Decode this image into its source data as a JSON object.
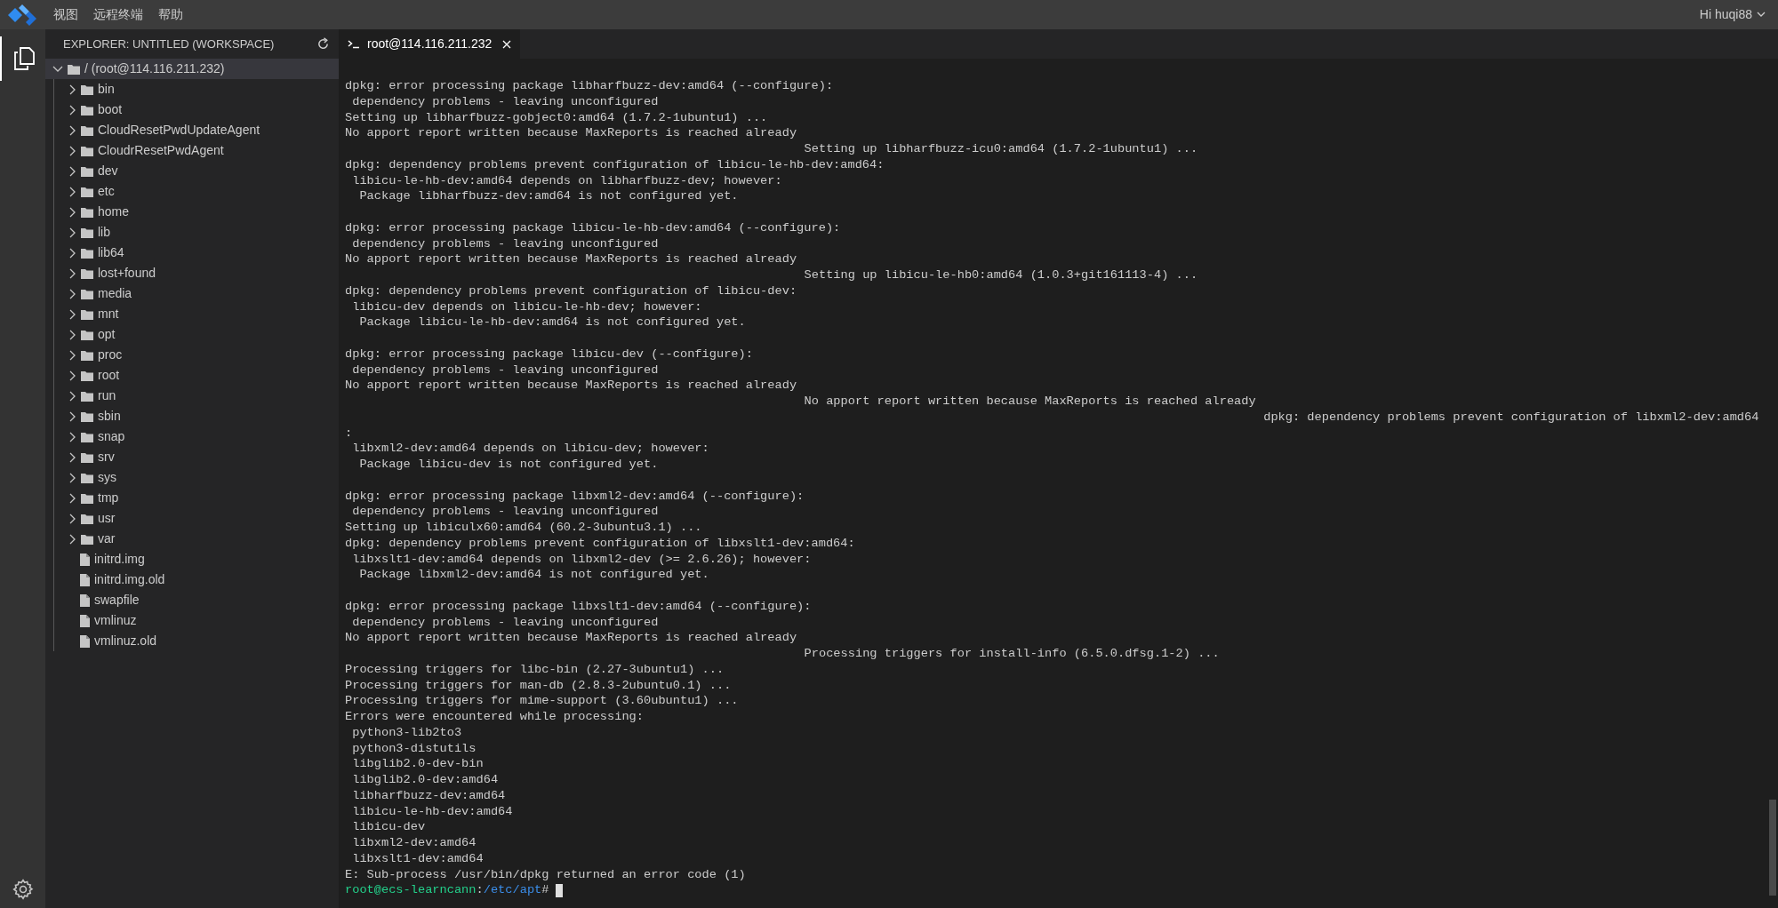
{
  "menu_bar": {
    "items": [
      "视图",
      "远程终端",
      "帮助"
    ],
    "user": "Hi huqi88"
  },
  "explorer": {
    "title": "EXPLORER: UNTITLED (WORKSPACE)",
    "tree": [
      {
        "label": "/ (root@114.116.211.232)",
        "kind": "folder",
        "expanded": true,
        "selected": true,
        "children": [
          {
            "label": "bin",
            "kind": "folder",
            "expanded": false
          },
          {
            "label": "boot",
            "kind": "folder",
            "expanded": false
          },
          {
            "label": "CloudResetPwdUpdateAgent",
            "kind": "folder",
            "expanded": false
          },
          {
            "label": "CloudrResetPwdAgent",
            "kind": "folder",
            "expanded": false
          },
          {
            "label": "dev",
            "kind": "folder",
            "expanded": false
          },
          {
            "label": "etc",
            "kind": "folder",
            "expanded": false
          },
          {
            "label": "home",
            "kind": "folder",
            "expanded": false
          },
          {
            "label": "lib",
            "kind": "folder",
            "expanded": false
          },
          {
            "label": "lib64",
            "kind": "folder",
            "expanded": false
          },
          {
            "label": "lost+found",
            "kind": "folder",
            "expanded": false
          },
          {
            "label": "media",
            "kind": "folder",
            "expanded": false
          },
          {
            "label": "mnt",
            "kind": "folder",
            "expanded": false
          },
          {
            "label": "opt",
            "kind": "folder",
            "expanded": false
          },
          {
            "label": "proc",
            "kind": "folder",
            "expanded": false
          },
          {
            "label": "root",
            "kind": "folder",
            "expanded": false
          },
          {
            "label": "run",
            "kind": "folder",
            "expanded": false
          },
          {
            "label": "sbin",
            "kind": "folder",
            "expanded": false
          },
          {
            "label": "snap",
            "kind": "folder",
            "expanded": false
          },
          {
            "label": "srv",
            "kind": "folder",
            "expanded": false
          },
          {
            "label": "sys",
            "kind": "folder",
            "expanded": false
          },
          {
            "label": "tmp",
            "kind": "folder",
            "expanded": false
          },
          {
            "label": "usr",
            "kind": "folder",
            "expanded": false
          },
          {
            "label": "var",
            "kind": "folder",
            "expanded": false
          },
          {
            "label": "initrd.img",
            "kind": "file"
          },
          {
            "label": "initrd.img.old",
            "kind": "file"
          },
          {
            "label": "swapfile",
            "kind": "file"
          },
          {
            "label": "vmlinuz",
            "kind": "file"
          },
          {
            "label": "vmlinuz.old",
            "kind": "file"
          }
        ]
      }
    ]
  },
  "tabs": [
    {
      "label": "root@114.116.211.232",
      "selected": true
    }
  ],
  "terminal": {
    "lines": [
      {
        "kind": "line",
        "text": "dpkg: error processing package libharfbuzz-dev:amd64 (--configure):"
      },
      {
        "kind": "line",
        "text": " dependency problems - leaving unconfigured"
      },
      {
        "kind": "line",
        "text": "Setting up libharfbuzz-gobject0:amd64 (1.7.2-1ubuntu1) ..."
      },
      {
        "kind": "line",
        "text": "No apport report written because MaxReports is reached already"
      },
      {
        "kind": "mid",
        "text": "Setting up libharfbuzz-icu0:amd64 (1.7.2-1ubuntu1) ..."
      },
      {
        "kind": "line",
        "text": "dpkg: dependency problems prevent configuration of libicu-le-hb-dev:amd64:"
      },
      {
        "kind": "line",
        "text": " libicu-le-hb-dev:amd64 depends on libharfbuzz-dev; however:"
      },
      {
        "kind": "line",
        "text": "  Package libharfbuzz-dev:amd64 is not configured yet."
      },
      {
        "kind": "blank"
      },
      {
        "kind": "line",
        "text": "dpkg: error processing package libicu-le-hb-dev:amd64 (--configure):"
      },
      {
        "kind": "line",
        "text": " dependency problems - leaving unconfigured"
      },
      {
        "kind": "line",
        "text": "No apport report written because MaxReports is reached already"
      },
      {
        "kind": "mid",
        "text": "Setting up libicu-le-hb0:amd64 (1.0.3+git161113-4) ..."
      },
      {
        "kind": "line",
        "text": "dpkg: dependency problems prevent configuration of libicu-dev:"
      },
      {
        "kind": "line",
        "text": " libicu-dev depends on libicu-le-hb-dev; however:"
      },
      {
        "kind": "line",
        "text": "  Package libicu-le-hb-dev:amd64 is not configured yet."
      },
      {
        "kind": "blank"
      },
      {
        "kind": "line",
        "text": "dpkg: error processing package libicu-dev (--configure):"
      },
      {
        "kind": "line",
        "text": " dependency problems - leaving unconfigured"
      },
      {
        "kind": "line",
        "text": "No apport report written because MaxReports is reached already"
      },
      {
        "kind": "mid",
        "text": "No apport report written because MaxReports is reached already"
      },
      {
        "kind": "far",
        "text": "dpkg: dependency problems prevent configuration of libxml2-dev:amd64"
      },
      {
        "kind": "line",
        "text": ":"
      },
      {
        "kind": "line",
        "text": " libxml2-dev:amd64 depends on libicu-dev; however:"
      },
      {
        "kind": "line",
        "text": "  Package libicu-dev is not configured yet."
      },
      {
        "kind": "blank"
      },
      {
        "kind": "line",
        "text": "dpkg: error processing package libxml2-dev:amd64 (--configure):"
      },
      {
        "kind": "line",
        "text": " dependency problems - leaving unconfigured"
      },
      {
        "kind": "line",
        "text": "Setting up libiculx60:amd64 (60.2-3ubuntu3.1) ..."
      },
      {
        "kind": "line",
        "text": "dpkg: dependency problems prevent configuration of libxslt1-dev:amd64:"
      },
      {
        "kind": "line",
        "text": " libxslt1-dev:amd64 depends on libxml2-dev (>= 2.6.26); however:"
      },
      {
        "kind": "line",
        "text": "  Package libxml2-dev:amd64 is not configured yet."
      },
      {
        "kind": "blank"
      },
      {
        "kind": "line",
        "text": "dpkg: error processing package libxslt1-dev:amd64 (--configure):"
      },
      {
        "kind": "line",
        "text": " dependency problems - leaving unconfigured"
      },
      {
        "kind": "line",
        "text": "No apport report written because MaxReports is reached already"
      },
      {
        "kind": "mid",
        "text": "Processing triggers for install-info (6.5.0.dfsg.1-2) ..."
      },
      {
        "kind": "line",
        "text": "Processing triggers for libc-bin (2.27-3ubuntu1) ..."
      },
      {
        "kind": "line",
        "text": "Processing triggers for man-db (2.8.3-2ubuntu0.1) ..."
      },
      {
        "kind": "line",
        "text": "Processing triggers for mime-support (3.60ubuntu1) ..."
      },
      {
        "kind": "line",
        "text": "Errors were encountered while processing:"
      },
      {
        "kind": "line",
        "text": " python3-lib2to3"
      },
      {
        "kind": "line",
        "text": " python3-distutils"
      },
      {
        "kind": "line",
        "text": " libglib2.0-dev-bin"
      },
      {
        "kind": "line",
        "text": " libglib2.0-dev:amd64"
      },
      {
        "kind": "line",
        "text": " libharfbuzz-dev:amd64"
      },
      {
        "kind": "line",
        "text": " libicu-le-hb-dev:amd64"
      },
      {
        "kind": "line",
        "text": " libicu-dev"
      },
      {
        "kind": "line",
        "text": " libxml2-dev:amd64"
      },
      {
        "kind": "line",
        "text": " libxslt1-dev:amd64"
      },
      {
        "kind": "line",
        "text": "E: Sub-process /usr/bin/dpkg returned an error code (1)"
      }
    ],
    "prompt": {
      "user": "root@ecs-learncann",
      "separator": ":",
      "path": "/etc/apt",
      "symbol": "#"
    }
  }
}
